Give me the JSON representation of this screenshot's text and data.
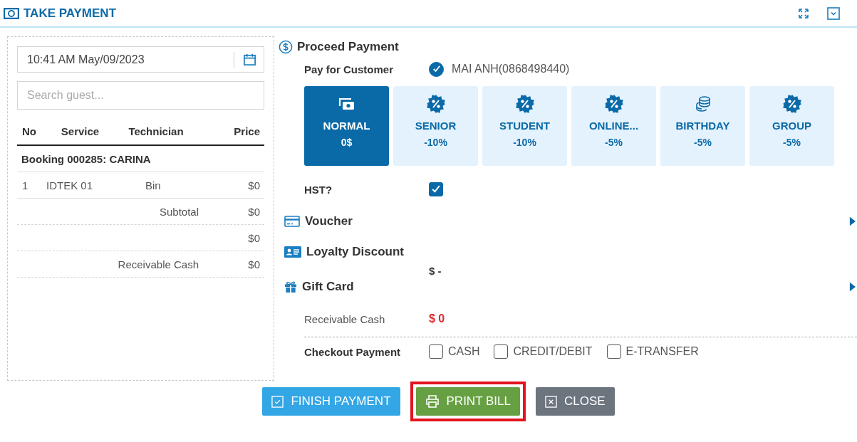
{
  "window": {
    "title": "TAKE PAYMENT"
  },
  "left": {
    "datetime": "10:41 AM May/09/2023",
    "search": {
      "placeholder": "Search guest..."
    },
    "columns": [
      "No",
      "Service",
      "Technician",
      "Price"
    ],
    "booking": "Booking 000285: CARINA",
    "rows": [
      {
        "no": "1",
        "service": "IDTEK 01",
        "technician": "Bin",
        "price": "$0"
      }
    ],
    "totals": [
      {
        "label": "Subtotal",
        "value": "$0"
      },
      {
        "value": "$0"
      },
      {
        "label": "Receivable Cash",
        "value": "$0"
      }
    ]
  },
  "payment": {
    "title": "Proceed Payment",
    "customer_label": "Pay for Customer",
    "customer_checked": true,
    "customer": "MAI ANH(0868498440)",
    "discounts": [
      {
        "kind": "cash",
        "name": "NORMAL",
        "amount": "0$",
        "selected": true
      },
      {
        "kind": "percent",
        "name": "SENIOR",
        "amount": "-10%",
        "selected": false
      },
      {
        "kind": "percent",
        "name": "STUDENT",
        "amount": "-10%",
        "selected": false
      },
      {
        "kind": "percent",
        "name": "ONLINE...",
        "amount": "-5%",
        "selected": false
      },
      {
        "kind": "coins",
        "name": "BIRTHDAY",
        "amount": "-5%",
        "selected": false
      },
      {
        "kind": "percent",
        "name": "GROUP",
        "amount": "-5%",
        "selected": false
      }
    ],
    "hst_label": "HST?",
    "hst_checked": true,
    "sections": [
      {
        "kind": "card",
        "title": "Voucher",
        "arrow": true
      },
      {
        "kind": "id",
        "title": "Loyalty Discount",
        "arrow": false,
        "value": "$ -"
      },
      {
        "kind": "gift",
        "title": "Gift Card",
        "arrow": true
      }
    ],
    "receivable_label": "Receivable Cash",
    "receivable_value": "$ 0",
    "checkout_label": "Checkout Payment",
    "methods": [
      {
        "label": "CASH",
        "checked": false
      },
      {
        "label": "CREDIT/DEBIT",
        "checked": false
      },
      {
        "label": "E-TRANSFER",
        "checked": false
      }
    ]
  },
  "buttons": [
    {
      "kind": "finish",
      "label": "FINISH PAYMENT",
      "highlighted": false
    },
    {
      "kind": "print",
      "label": "PRINT BILL",
      "highlighted": true
    },
    {
      "kind": "close",
      "label": "CLOSE",
      "highlighted": false
    }
  ]
}
